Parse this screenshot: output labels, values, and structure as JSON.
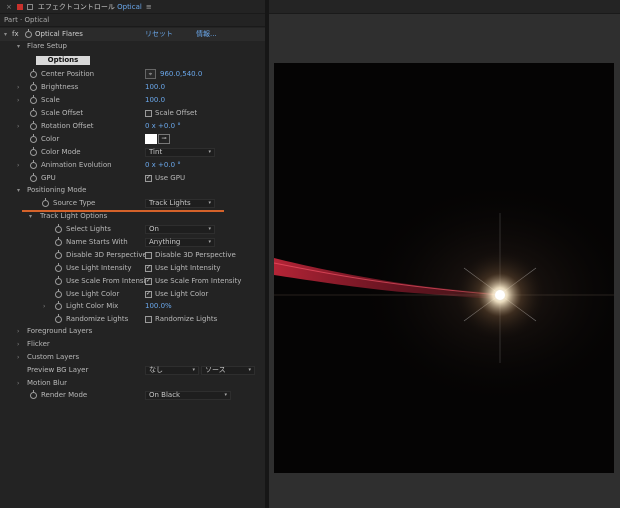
{
  "titlebar": {
    "close": "×",
    "title_jp": "エフェクトコントロール",
    "title_layer": "Optical",
    "menu": "≡"
  },
  "subtitle": "Part · Optical",
  "effect": {
    "fx": "fx",
    "name": "Optical Flares",
    "reset": "リセット",
    "about": "情報..."
  },
  "flare_setup": "Flare Setup",
  "options_button": "Options",
  "center_position": {
    "label": "Center Position",
    "value": "960.0,540.0"
  },
  "brightness": {
    "label": "Brightness",
    "value": "100.0"
  },
  "scale": {
    "label": "Scale",
    "value": "100.0"
  },
  "scale_offset": {
    "label": "Scale Offset",
    "checkbox": "Scale Offset"
  },
  "rotation_offset": {
    "label": "Rotation Offset",
    "value": "0 x +0.0 °"
  },
  "color": {
    "label": "Color"
  },
  "color_mode": {
    "label": "Color Mode",
    "value": "Tint"
  },
  "animation_evolution": {
    "label": "Animation Evolution",
    "value": "0 x +0.0 °"
  },
  "gpu": {
    "label": "GPU",
    "checkbox": "Use GPU"
  },
  "positioning_mode": "Positioning Mode",
  "source_type": {
    "label": "Source Type",
    "value": "Track Lights"
  },
  "track_light_options": "Track Light Options",
  "select_lights": {
    "label": "Select Lights",
    "value": "On"
  },
  "name_starts_with": {
    "label": "Name Starts With",
    "value": "Anything"
  },
  "disable_3d": {
    "label": "Disable 3D Perspective",
    "checkbox": "Disable 3D Perspective"
  },
  "use_light_intensity": {
    "label": "Use Light Intensity",
    "checkbox": "Use Light Intensity"
  },
  "use_scale_from_intensity": {
    "label": "Use Scale From Intensity",
    "checkbox": "Use Scale From Intensity"
  },
  "use_light_color": {
    "label": "Use Light Color",
    "checkbox": "Use Light Color"
  },
  "light_color_mix": {
    "label": "Light Color Mix",
    "value": "100.0%"
  },
  "randomize_lights": {
    "label": "Randomize Lights",
    "checkbox": "Randomize Lights"
  },
  "foreground_layers": "Foreground Layers",
  "flicker": "Flicker",
  "custom_layers": "Custom Layers",
  "preview_bg_layer": {
    "label": "Preview BG Layer",
    "value1": "なし",
    "value2": "ソース"
  },
  "motion_blur": "Motion Blur",
  "render_mode": {
    "label": "Render Mode",
    "value": "On Black"
  },
  "colors": {
    "accent": "#6aa7ea",
    "highlight": "#d4622a",
    "streak": "#c8283c"
  }
}
